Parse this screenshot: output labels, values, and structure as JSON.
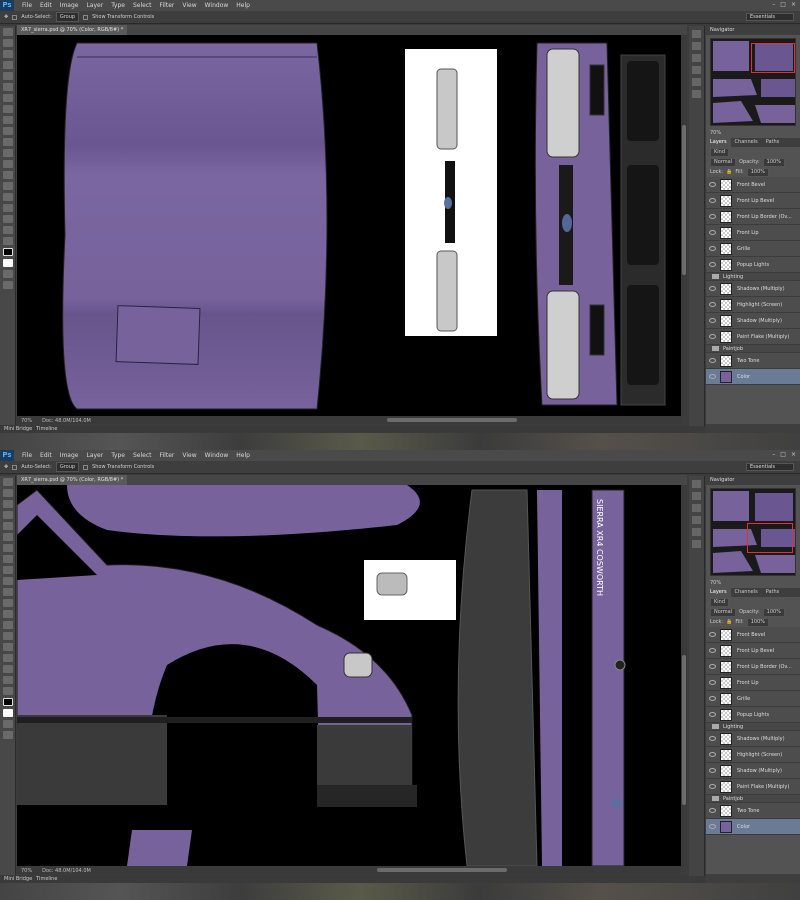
{
  "menu": [
    "File",
    "Edit",
    "Image",
    "Layer",
    "Type",
    "Select",
    "Filter",
    "View",
    "Window",
    "Help"
  ],
  "app_logo": "Ps",
  "window_controls": [
    "–",
    "□",
    "×"
  ],
  "options": {
    "auto_select": "Auto-Select:",
    "auto_select_value": "Group",
    "show_transform": "Show Transform Controls"
  },
  "workspace": "Essentials",
  "document_tab": "XR7_sierra.psd @ 70% (Color, RGB/8#) *",
  "status": {
    "zoom": "70%",
    "doc": "Doc: 48.0M/104.0M"
  },
  "timeline_tabs": [
    "Mini Bridge",
    "Timeline"
  ],
  "panel": {
    "navigator_title": "Navigator",
    "zoom_value": "70%",
    "tabs": [
      "Layers",
      "Channels",
      "Paths"
    ],
    "filter_kind": "Kind",
    "blend_mode": "Normal",
    "opacity_label": "Opacity:",
    "opacity_value": "100%",
    "lock_label": "Lock:",
    "fill_label": "Fill:",
    "fill_value": "100%"
  },
  "layers": [
    {
      "name": "Front Bevel",
      "type": "layer"
    },
    {
      "name": "Front Lip Bevel",
      "type": "layer"
    },
    {
      "name": "Front Lip Border (Ov...",
      "type": "layer"
    },
    {
      "name": "Front Lip",
      "type": "layer"
    },
    {
      "name": "Grille",
      "type": "layer"
    },
    {
      "name": "Popup Lights",
      "type": "layer"
    },
    {
      "name": "Lighting",
      "type": "group"
    },
    {
      "name": "Shadows (Multiply)",
      "type": "layer"
    },
    {
      "name": "Highlight (Screen)",
      "type": "layer"
    },
    {
      "name": "Shadow (Multiply)",
      "type": "layer"
    },
    {
      "name": "Paint Flake (Multiply)",
      "type": "layer"
    },
    {
      "name": "Paintjob",
      "type": "group"
    },
    {
      "name": "Two Tone",
      "type": "layer"
    },
    {
      "name": "Color",
      "type": "layer",
      "selected": true
    }
  ],
  "canvas_text": {
    "side_badge": "SIERRA XR4 COSWORTH"
  },
  "colors": {
    "paint": "#77629c",
    "panel_bg": "#535353",
    "canvas_bg": "#000000",
    "selected_layer": "#6a7c95"
  }
}
